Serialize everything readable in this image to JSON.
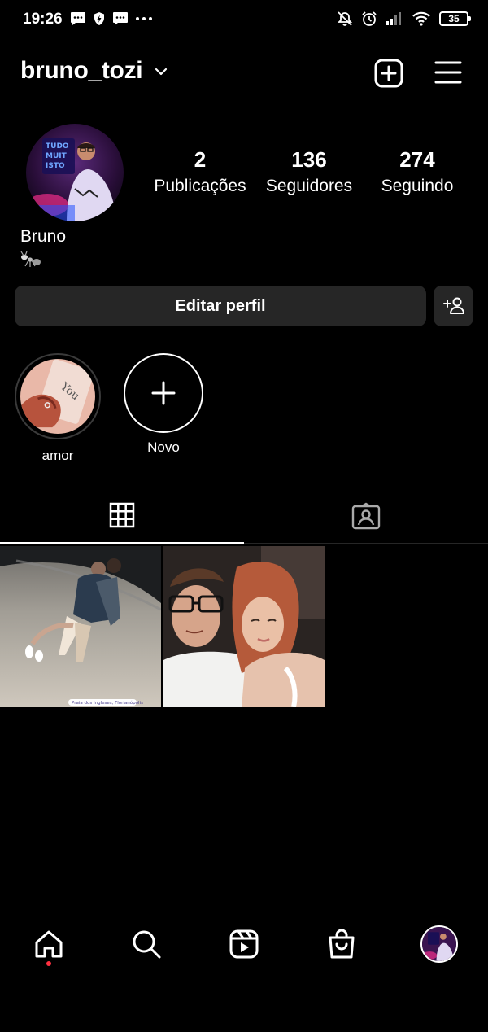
{
  "status_bar": {
    "time": "19:26",
    "battery": "35",
    "left_icons": [
      "message-icon",
      "shield-icon",
      "message-icon",
      "more-dots-icon"
    ],
    "right_icons": [
      "muted-bell-icon",
      "alarm-icon",
      "signal-icon",
      "wifi-icon",
      "battery-icon"
    ]
  },
  "header": {
    "username": "bruno_tozi",
    "icons": [
      "chevron-down-icon",
      "new-post-icon",
      "hamburger-menu-icon"
    ]
  },
  "profile": {
    "stats": [
      {
        "value": "2",
        "label": "Publicações"
      },
      {
        "value": "136",
        "label": "Seguidores"
      },
      {
        "value": "274",
        "label": "Seguindo"
      }
    ],
    "display_name": "Bruno",
    "bio_icon": "ant-icon",
    "edit_button": "Editar perfil",
    "suggest_icon": "add-person-icon"
  },
  "highlights": [
    {
      "label": "amor"
    },
    {
      "label": "Novo"
    }
  ],
  "tabs": [
    {
      "icon": "grid-icon",
      "active": true
    },
    {
      "icon": "tagged-person-icon",
      "active": false
    }
  ],
  "posts": [
    {
      "caption": "Praia dos Ingleses, Florianópolis"
    },
    {}
  ],
  "bottom_nav": [
    {
      "icon": "home-icon",
      "active": true
    },
    {
      "icon": "search-icon"
    },
    {
      "icon": "reels-icon"
    },
    {
      "icon": "shop-bag-icon"
    },
    {
      "icon": "profile-avatar"
    }
  ],
  "colors": {
    "background": "#000000",
    "button": "#262626",
    "text": "#ffffff",
    "notification_dot": "#ff3040"
  }
}
